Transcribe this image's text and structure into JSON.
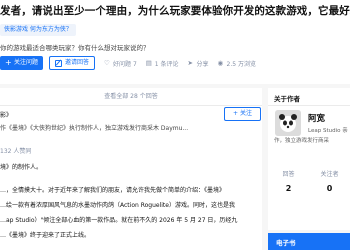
{
  "question": {
    "title": "发者，请说出至少一个理由，为什么玩家要体验你开发的这款游戏，它最好玩的点在",
    "topic_tag": "侠影游戏  何为东方为侠？",
    "subtitle": "你的游戏最适合哪类玩家？你有什么想对玩家说的？",
    "follow_button": "关注问题",
    "invite_button": "邀请回答",
    "meta": [
      {
        "icon": "heart-icon",
        "label": "好问题 7"
      },
      {
        "icon": "comment-icon",
        "label": "1 条评论"
      },
      {
        "icon": "share-icon",
        "label": "分享"
      },
      {
        "icon": "eye-icon",
        "label": "2.5 万浏览"
      }
    ]
  },
  "answers": {
    "view_all": "查看全部 28 个回答",
    "lines": [
      "影》",
      "作《墨境》《大侠狗世纪》执行制作人，独立游戏发行商采木 Daymu...",
      "132 人赞同",
      "境》的制作人。",
      "…，全情摸大十。对于近年来了解我们的朋友，请允许我先做个简单的介绍：《墨境》",
      "…绘一款有着浓厚国风气息的水墨动作肉鸽（Action Roguelite）游戏。同时，这也是我",
      "…ap Studio）\"倾注全部心血的第一款作品。就在前不久的 2026 年 5 月 27 日，历经九",
      "…《墨境》终于迎来了正式上线。"
    ],
    "follow_button": "+ 关注"
  },
  "sidebar": {
    "section_title": "关于作者",
    "author_name": "阿宽",
    "author_bio": "Leap Studio 亲",
    "author_bio_2": "作，独立游戏发行商采",
    "stats": [
      {
        "label": "回答",
        "value": "2"
      },
      {
        "label": "关注者",
        "value": "0"
      }
    ],
    "ebook_label": "电子书"
  }
}
